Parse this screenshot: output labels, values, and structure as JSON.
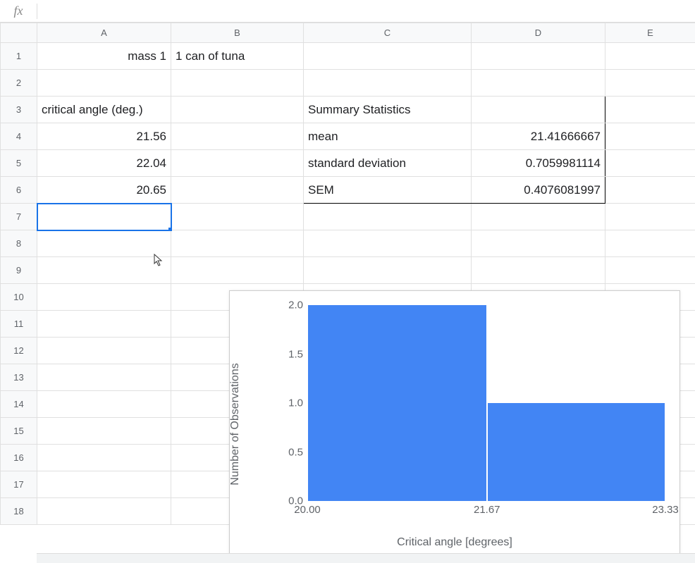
{
  "formula_bar": {
    "fx_label": "fx",
    "value": ""
  },
  "columns": [
    "A",
    "B",
    "C",
    "D",
    "E"
  ],
  "rows": [
    "1",
    "2",
    "3",
    "4",
    "5",
    "6",
    "7",
    "8",
    "9",
    "10",
    "11",
    "12",
    "13",
    "14",
    "15",
    "16",
    "17",
    "18"
  ],
  "cells": {
    "A1": "mass 1",
    "B1": "1 can of tuna",
    "A3": "critical angle (deg.)",
    "A4": "21.56",
    "A5": "22.04",
    "A6": "20.65",
    "C3": "Summary Statistics",
    "C4": "mean",
    "D4": "21.41666667",
    "C5": "standard deviation",
    "D5": "0.7059981114",
    "C6": "SEM",
    "D6": "0.4076081997"
  },
  "selected_cell": "A7",
  "chart_data": {
    "type": "bar",
    "xlabel": "Critical angle [degrees]",
    "ylabel": "Number of Observations",
    "x_ticks": [
      "20.00",
      "21.67",
      "23.33"
    ],
    "y_ticks": [
      "0.0",
      "0.5",
      "1.0",
      "1.5",
      "2.0"
    ],
    "ylim": [
      0,
      2
    ],
    "bins": [
      {
        "start": 20.0,
        "end": 21.67,
        "count": 2
      },
      {
        "start": 21.67,
        "end": 23.33,
        "count": 1
      }
    ],
    "bar_color": "#4285f4"
  }
}
